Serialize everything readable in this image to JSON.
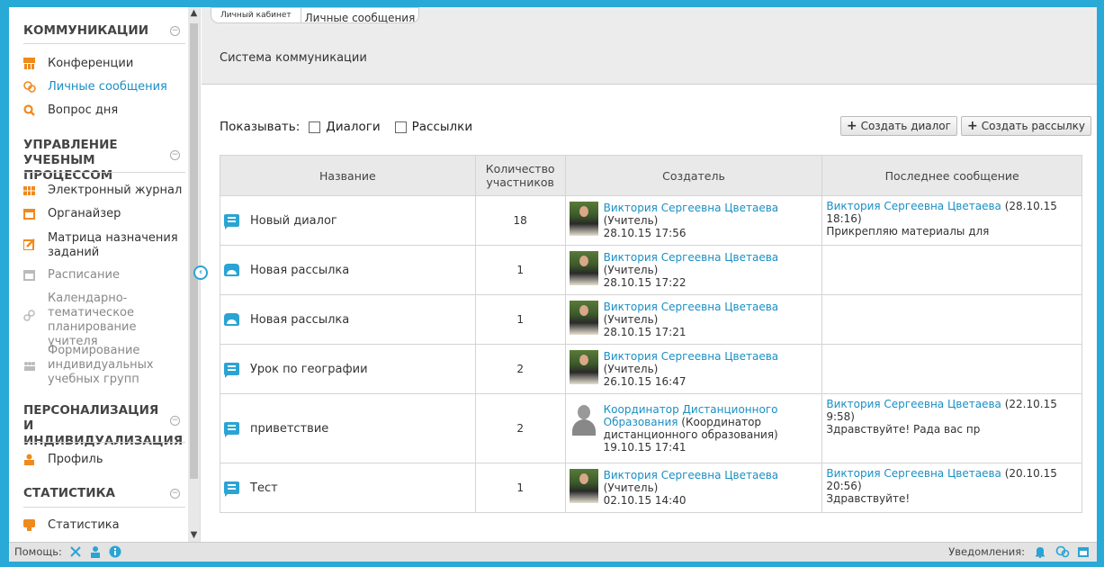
{
  "sidebar": {
    "sections": [
      {
        "title": "КОММУНИКАЦИИ"
      },
      {
        "title": "УПРАВЛЕНИЕ УЧЕБНЫМ ПРОЦЕССОМ"
      },
      {
        "title": "ПЕРСОНАЛИЗАЦИЯ И ИНДИВИДУАЛИЗАЦИЯ"
      },
      {
        "title": "СТАТИСТИКА"
      }
    ],
    "items": [
      {
        "label": "Конференции"
      },
      {
        "label": "Личные сообщения"
      },
      {
        "label": "Вопрос дня"
      },
      {
        "label": "Электронный журнал"
      },
      {
        "label": "Органайзер"
      },
      {
        "label": "Матрица назначения заданий"
      },
      {
        "label": "Расписание"
      },
      {
        "label": "Календарно-тематическое планирование учителя"
      },
      {
        "label": "Формирование индивидуальных учебных групп"
      },
      {
        "label": "Профиль"
      },
      {
        "label": "Статистика"
      }
    ]
  },
  "breadcrumbs": [
    "Личный кабинет",
    "Личные сообщения"
  ],
  "page_title": "Система коммуникации",
  "filters": {
    "show_label": "Показывать:",
    "dialogs": "Диалоги",
    "mailings": "Рассылки"
  },
  "buttons": {
    "create_dialog": "Создать диалог",
    "create_mailing": "Создать рассылку"
  },
  "table": {
    "headers": [
      "Название",
      "Количество участников",
      "Создатель",
      "Последнее сообщение"
    ],
    "rows": [
      {
        "name": "Новый диалог",
        "count": "18",
        "creator_name": "Виктория Сергеевна Цветаева",
        "creator_role": "(Учитель)",
        "created": "28.10.15 17:56",
        "last_author": "Виктория Сергеевна Цветаева",
        "last_date": "(28.10.15 18:16)",
        "last_text": "Прикрепляю материалы для"
      },
      {
        "name": "Новая рассылка",
        "count": "1",
        "creator_name": "Виктория Сергеевна Цветаева",
        "creator_role": "(Учитель)",
        "created": "28.10.15 17:22",
        "last_author": "",
        "last_date": "",
        "last_text": ""
      },
      {
        "name": "Новая рассылка",
        "count": "1",
        "creator_name": "Виктория Сергеевна Цветаева",
        "creator_role": "(Учитель)",
        "created": "28.10.15 17:21",
        "last_author": "",
        "last_date": "",
        "last_text": ""
      },
      {
        "name": "Урок по географии",
        "count": "2",
        "creator_name": "Виктория Сергеевна Цветаева",
        "creator_role": "(Учитель)",
        "created": "26.10.15 16:47",
        "last_author": "",
        "last_date": "",
        "last_text": ""
      },
      {
        "name": "приветствие",
        "count": "2",
        "creator_name": "Координатор Дистанционного Образования",
        "creator_role": "(Координатор дистанционного образования)",
        "created": "19.10.15 17:41",
        "last_author": "Виктория Сергеевна Цветаева",
        "last_date": "(22.10.15 9:58)",
        "last_text": "Здравствуйте! Рада вас пр"
      },
      {
        "name": "Тест",
        "count": "1",
        "creator_name": "Виктория Сергеевна Цветаева",
        "creator_role": "(Учитель)",
        "created": "02.10.15 14:40",
        "last_author": "Виктория Сергеевна Цветаева",
        "last_date": "(20.10.15 20:56)",
        "last_text": "Здравствуйте!"
      }
    ]
  },
  "footer": {
    "help_label": "Помощь:",
    "notifications_label": "Уведомления:"
  },
  "colors": {
    "accent": "#2aa4d4",
    "link": "#1a8fc4",
    "orange": "#f08a1c"
  }
}
